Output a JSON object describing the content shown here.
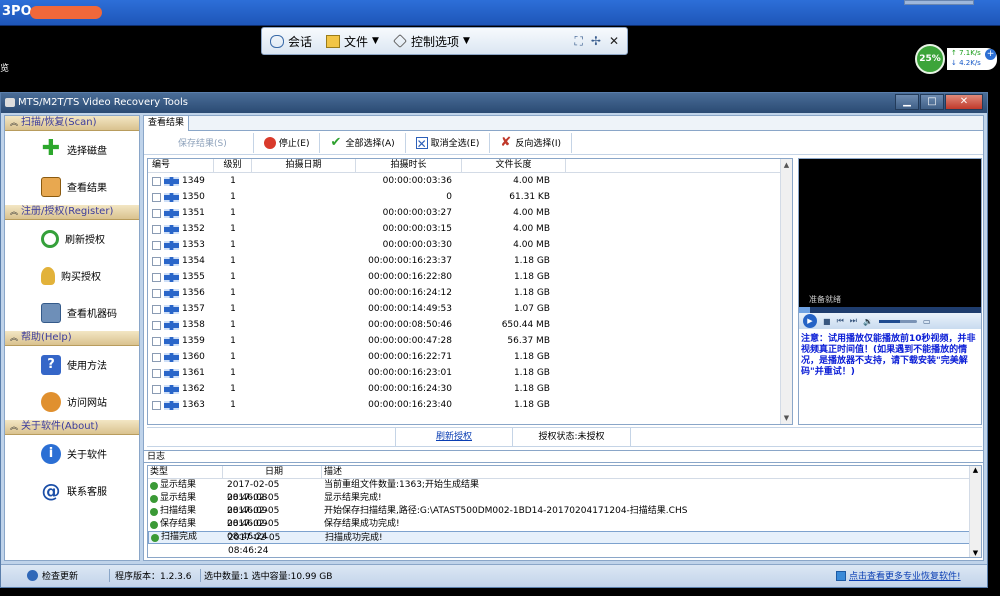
{
  "remote": {
    "host_title": "3PO",
    "left_edge_text": "览",
    "toolbar": {
      "items": [
        {
          "icon": "chat-icon",
          "label": "会话",
          "has_menu": false
        },
        {
          "icon": "file-transfer-icon",
          "label": "文件",
          "has_menu": true
        },
        {
          "icon": "control-options-icon",
          "label": "控制选项",
          "has_menu": true
        }
      ],
      "right_icons": [
        "fit-screen-icon",
        "pin-icon",
        "close-icon"
      ]
    },
    "net_widget": {
      "percent": "25%",
      "up_rate": "7.1K/s",
      "down_rate": "4.2K/s"
    }
  },
  "app": {
    "title": "MTS/M2T/TS Video Recovery Tools",
    "window_buttons": [
      "minimize",
      "maximize",
      "close"
    ],
    "sidebar": {
      "groups": [
        {
          "title": "扫描/恢复(Scan)",
          "items": [
            {
              "label": "选择磁盘",
              "icon": "add-disk-icon"
            },
            {
              "label": "查看结果",
              "icon": "results-clipboard-icon"
            }
          ]
        },
        {
          "title": "注册/授权(Register)",
          "items": [
            {
              "label": "刷新授权",
              "icon": "refresh-icon"
            },
            {
              "label": "购买授权",
              "icon": "key-icon"
            },
            {
              "label": "查看机器码",
              "icon": "machine-code-icon"
            }
          ]
        },
        {
          "title": "帮助(Help)",
          "items": [
            {
              "label": "使用方法",
              "icon": "help-book-icon"
            },
            {
              "label": "访问网站",
              "icon": "website-icon"
            }
          ]
        },
        {
          "title": "关于软件(About)",
          "items": [
            {
              "label": "关于软件",
              "icon": "info-icon"
            },
            {
              "label": "联系客服",
              "icon": "at-contact-icon"
            }
          ]
        }
      ]
    },
    "tab": "查看结果",
    "actions": [
      {
        "label": "保存结果(S)",
        "icon": "",
        "disabled": true
      },
      {
        "label": "停止(E)",
        "icon": "stop-icon",
        "disabled": false
      },
      {
        "label": "全部选择(A)",
        "icon": "check-icon",
        "disabled": false
      },
      {
        "label": "取消全选(E)",
        "icon": "deselect-icon",
        "disabled": false
      },
      {
        "label": "反向选择(I)",
        "icon": "invert-select-icon",
        "disabled": false
      }
    ],
    "columns": [
      "编号",
      "级别",
      "拍摄日期",
      "拍摄时长",
      "文件长度"
    ],
    "rows": [
      {
        "id": "1349",
        "level": "1",
        "date": "",
        "duration": "00:00:00:03:36",
        "size": "4.00 MB"
      },
      {
        "id": "1350",
        "level": "1",
        "date": "",
        "duration": "0",
        "size": "61.31 KB"
      },
      {
        "id": "1351",
        "level": "1",
        "date": "",
        "duration": "00:00:00:03:27",
        "size": "4.00 MB"
      },
      {
        "id": "1352",
        "level": "1",
        "date": "",
        "duration": "00:00:00:03:15",
        "size": "4.00 MB"
      },
      {
        "id": "1353",
        "level": "1",
        "date": "",
        "duration": "00:00:00:03:30",
        "size": "4.00 MB"
      },
      {
        "id": "1354",
        "level": "1",
        "date": "",
        "duration": "00:00:00:16:23:37",
        "size": "1.18 GB"
      },
      {
        "id": "1355",
        "level": "1",
        "date": "",
        "duration": "00:00:00:16:22:80",
        "size": "1.18 GB"
      },
      {
        "id": "1356",
        "level": "1",
        "date": "",
        "duration": "00:00:00:16:24:12",
        "size": "1.18 GB"
      },
      {
        "id": "1357",
        "level": "1",
        "date": "",
        "duration": "00:00:00:14:49:53",
        "size": "1.07 GB"
      },
      {
        "id": "1358",
        "level": "1",
        "date": "",
        "duration": "00:00:00:08:50:46",
        "size": "650.44 MB"
      },
      {
        "id": "1359",
        "level": "1",
        "date": "",
        "duration": "00:00:00:00:47:28",
        "size": "56.37 MB"
      },
      {
        "id": "1360",
        "level": "1",
        "date": "",
        "duration": "00:00:00:16:22:71",
        "size": "1.18 GB"
      },
      {
        "id": "1361",
        "level": "1",
        "date": "",
        "duration": "00:00:00:16:23:01",
        "size": "1.18 GB"
      },
      {
        "id": "1362",
        "level": "1",
        "date": "",
        "duration": "00:00:00:16:24:30",
        "size": "1.18 GB"
      },
      {
        "id": "1363",
        "level": "1",
        "date": "",
        "duration": "00:00:00:16:23:40",
        "size": "1.18 GB"
      }
    ],
    "preview": {
      "status": "准备就绪",
      "notice": "注意：试用播放仅能播放前10秒视频，并非视频真正时间值！(如果遇到不能播放的情况，是播放器不支持，请下载安装\"完美解码\"并重试！)",
      "seek_fraction": 0.06,
      "volume_fraction": 0.55
    },
    "register": {
      "link": "刷新授权",
      "status": "授权状态:未授权"
    },
    "log": {
      "title": "日志",
      "columns": [
        "类型",
        "日期",
        "描述"
      ],
      "rows": [
        {
          "type": "显示结果",
          "date": "2017-02-05 08:46:08",
          "desc": "当前重组文件数量:1363;开始生成结果"
        },
        {
          "type": "显示结果",
          "date": "2017-02-05 08:46:09",
          "desc": "显示结果完成!"
        },
        {
          "type": "扫描结果",
          "date": "2017-02-05 08:46:09",
          "desc": "开始保存扫描结果,路径:G:\\ATAST500DM002-1BD14-20170204171204-扫描结果.CHS"
        },
        {
          "type": "保存结果",
          "date": "2017-02-05 08:46:24",
          "desc": "保存结果成功完成!"
        },
        {
          "type": "扫描完成",
          "date": "2017-02-05 08:46:24",
          "desc": "扫描成功完成!"
        }
      ]
    },
    "statusbar": {
      "update": "检查更新",
      "version": "程序版本：1.2.3.6",
      "selection": "选中数量:1 选中容量:10.99 GB",
      "more": "点击查看更多专业恢复软件!"
    }
  }
}
